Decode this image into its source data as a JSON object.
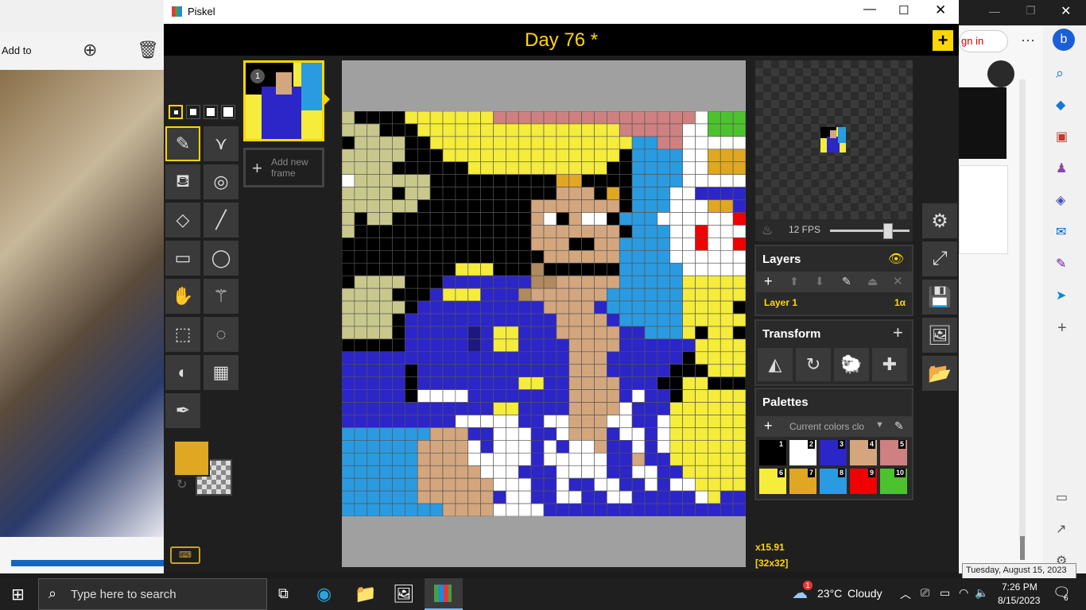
{
  "photo_app": {
    "add_to_label": "Add to"
  },
  "window": {
    "title": "Piskel"
  },
  "header": {
    "doc_title": "Day 76 *",
    "add_icon": "plus-icon"
  },
  "frames": {
    "frame_index": "1",
    "add_frame_label": "Add new frame"
  },
  "preview": {
    "fps_label": "12 FPS",
    "fps_fraction": 0.72
  },
  "layers": {
    "title": "Layers",
    "layer_name": "Layer 1",
    "layer_alpha": "1α"
  },
  "transform": {
    "title": "Transform"
  },
  "palettes": {
    "title": "Palettes",
    "selected": "Current colors clo",
    "swatches": [
      {
        "num": "1",
        "color": "#000000"
      },
      {
        "num": "2",
        "color": "#ffffff"
      },
      {
        "num": "3",
        "color": "#2c25c7"
      },
      {
        "num": "4",
        "color": "#d3a67e"
      },
      {
        "num": "5",
        "color": "#cf8080"
      },
      {
        "num": "6",
        "color": "#f5ec3b"
      },
      {
        "num": "7",
        "color": "#e0a722"
      },
      {
        "num": "8",
        "color": "#2a9be0"
      },
      {
        "num": "9",
        "color": "#f00000"
      },
      {
        "num": "10",
        "color": "#4cc32e"
      }
    ]
  },
  "status": {
    "zoom": "x15.91",
    "size": "[32x32]"
  },
  "colors": {
    "primary": "#e0a722",
    "accent": "#ffd700"
  },
  "edge": {
    "sign_in": "gn in"
  },
  "taskbar": {
    "search_placeholder": "Type here to search",
    "temp": "23°C",
    "weather": "Cloudy",
    "weather_badge": "1",
    "time": "7:26 PM",
    "date": "8/15/2023",
    "notif_count": "6",
    "tooltip": "Tuesday, August 15, 2023"
  }
}
